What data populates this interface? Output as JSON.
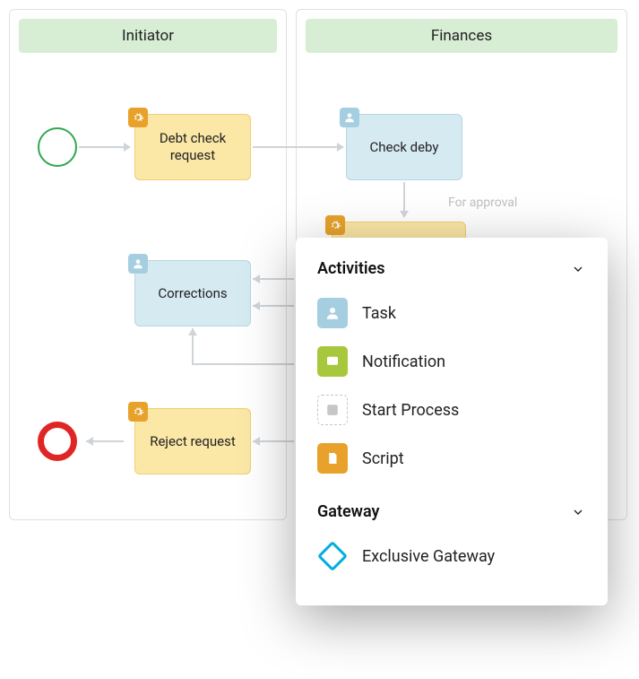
{
  "lanes": {
    "initiator": {
      "title": "Initiator"
    },
    "finances": {
      "title": "Finances"
    }
  },
  "nodes": {
    "start": {
      "kind": "start-event"
    },
    "debt_check_request": {
      "label": "Debt check request",
      "kind": "service-task"
    },
    "check_deby": {
      "label": "Check deby",
      "kind": "user-task"
    },
    "corrections": {
      "label": "Corrections",
      "kind": "user-task"
    },
    "reject_request": {
      "label": "Reject request",
      "kind": "service-task"
    },
    "end": {
      "kind": "end-event"
    }
  },
  "edges": {
    "for_approval": {
      "label": "For approval"
    }
  },
  "palette": {
    "sections": {
      "activities": {
        "title": "Activities",
        "items": {
          "task": {
            "label": "Task"
          },
          "notification": {
            "label": "Notification"
          },
          "start_process": {
            "label": "Start Process"
          },
          "script": {
            "label": "Script"
          }
        }
      },
      "gateway": {
        "title": "Gateway",
        "items": {
          "exclusive_gateway": {
            "label": "Exclusive Gateway"
          }
        }
      }
    }
  }
}
